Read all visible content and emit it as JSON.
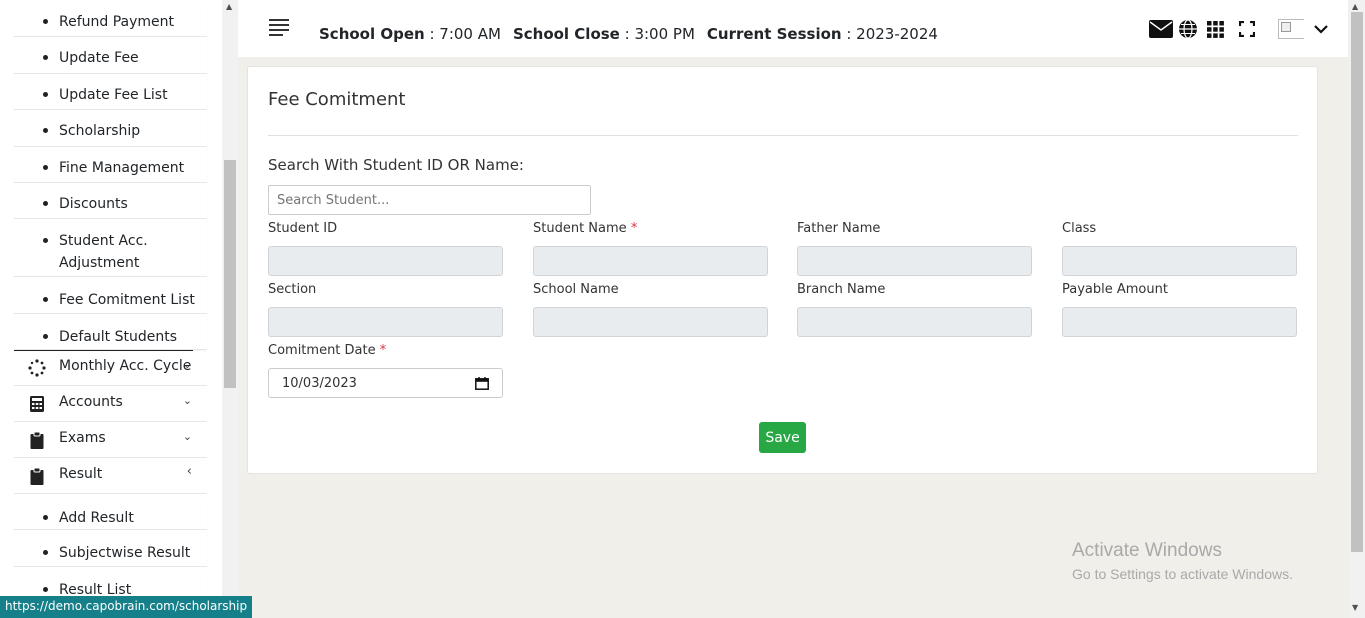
{
  "sidebar": {
    "sub_items": [
      {
        "label": "Refund Payment"
      },
      {
        "label": "Update Fee"
      },
      {
        "label": "Update Fee List"
      },
      {
        "label": "Scholarship"
      },
      {
        "label": "Fine Management"
      },
      {
        "label": "Discounts"
      },
      {
        "label": "Student Acc.",
        "label2": "Adjustment"
      },
      {
        "label": "Fee Comitment List"
      },
      {
        "label": "Default Students"
      }
    ],
    "main_items": [
      {
        "label": "Monthly Acc. Cycle",
        "icon": "spinner-icon"
      },
      {
        "label": "Accounts",
        "icon": "calculator-icon"
      },
      {
        "label": "Exams",
        "icon": "clipboard-icon"
      },
      {
        "label": "Result",
        "icon": "clipboard-icon"
      }
    ],
    "result_items": [
      {
        "label": "Add Result"
      },
      {
        "label": "Subjectwise Result"
      },
      {
        "label": "Result List"
      }
    ]
  },
  "status_url": "https://demo.capobrain.com/scholarship",
  "header": {
    "school_open_label": "School Open",
    "school_open_value": " : 7:00 AM",
    "school_close_label": "School Close",
    "school_close_value": " : 3:00 PM",
    "session_label": "Current Session",
    "session_value": " : 2023-2024",
    "icons": [
      "envelope-icon",
      "globe-icon",
      "grid-icon",
      "fullscreen-icon",
      "avatar",
      "chevron-down-icon"
    ]
  },
  "form": {
    "title": "Fee Comitment",
    "search_label": "Search With Student ID OR Name:",
    "search_placeholder": "Search Student...",
    "fields": {
      "student_id": "Student ID",
      "student_name": "Student Name",
      "father_name": "Father Name",
      "class": "Class",
      "section": "Section",
      "school_name": "School Name",
      "branch_name": "Branch Name",
      "payable_amount": "Payable Amount",
      "comitment_date": "Comitment Date"
    },
    "required_mark": "*",
    "date_value": "10/03/2023",
    "save_label": "Save"
  },
  "watermark": {
    "line1": "Activate Windows",
    "line2": "Go to Settings to activate Windows."
  },
  "colors": {
    "save": "#28a745",
    "required": "#dc3545",
    "status_bar": "#16808a"
  }
}
